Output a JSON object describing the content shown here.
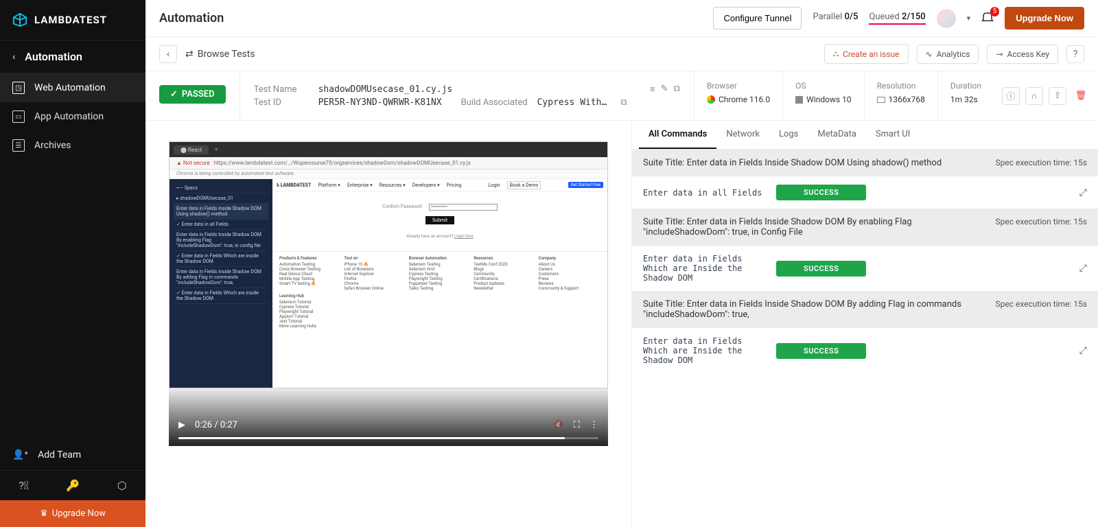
{
  "brand": "LAMBDATEST",
  "page_title": "Automation",
  "sidebar": {
    "back_title": "Automation",
    "items": [
      {
        "label": "Web Automation"
      },
      {
        "label": "App Automation"
      },
      {
        "label": "Archives"
      }
    ],
    "add_team": "Add Team",
    "upgrade": "Upgrade Now"
  },
  "topbar": {
    "configure": "Configure Tunnel",
    "parallel_label": "Parallel",
    "parallel_val": "0/5",
    "queued_label": "Queued",
    "queued_val": "2/150",
    "notif_count": "5",
    "upgrade": "Upgrade Now"
  },
  "toolbar": {
    "browse": "Browse Tests",
    "create_issue": "Create an issue",
    "analytics": "Analytics",
    "access_key": "Access Key",
    "help": "?"
  },
  "status": "PASSED",
  "test": {
    "name_label": "Test Name",
    "name": "shadowDOMUsecase_01.cy.js",
    "id_label": "Test ID",
    "id": "PER5R-NY3ND-QWRWR-K81NX",
    "build_label": "Build Associated",
    "build": "Cypress With…"
  },
  "env": {
    "browser_label": "Browser",
    "browser": "Chrome 116.0",
    "os_label": "OS",
    "os": "Windows 10",
    "res_label": "Resolution",
    "res": "1366x768",
    "dur_label": "Duration",
    "dur": "1m 32s"
  },
  "video": {
    "time": "0:26 / 0:27"
  },
  "cmd_tabs": [
    "All Commands",
    "Network",
    "Logs",
    "MetaData",
    "Smart UI"
  ],
  "suites": [
    {
      "title": "Suite Title: Enter data in Fields Inside Shadow DOM Using shadow() method",
      "time": "Spec execution time: 15s",
      "tests": [
        {
          "name": "Enter data in all Fields",
          "status": "SUCCESS"
        }
      ]
    },
    {
      "title": "Suite Title: Enter data in Fields Inside Shadow DOM By enabling Flag \"includeShadowDom\": true, in Config File",
      "time": "Spec execution time: 15s",
      "tests": [
        {
          "name": "Enter data in Fields Which are Inside the Shadow DOM",
          "status": "SUCCESS"
        }
      ]
    },
    {
      "title": "Suite Title: Enter data in Fields Inside Shadow DOM By adding Flag in commands \"includeShadowDom\": true,",
      "time": "Spec execution time: 15s",
      "tests": [
        {
          "name": "Enter data in Fields Which are Inside the Shadow DOM",
          "status": "SUCCESS"
        }
      ]
    }
  ]
}
